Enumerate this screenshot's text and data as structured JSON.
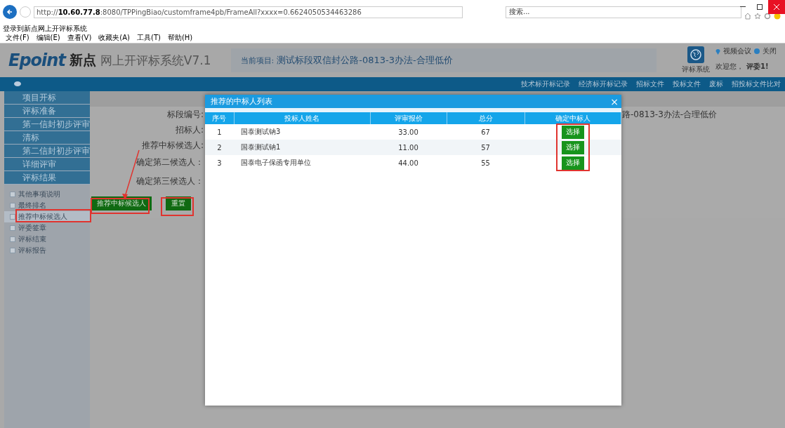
{
  "browser": {
    "url": "http://**10.60.77.8**:8080/TPPingBiao/customframe4pb/FrameAll?xxxx=0.6624050534463286",
    "search_placeholder": "搜索...",
    "tab_title": "登录到新点网上开评标系统",
    "menu": [
      "文件(F)",
      "编辑(E)",
      "查看(V)",
      "收藏夹(A)",
      "工具(T)",
      "帮助(H)"
    ]
  },
  "header": {
    "logo_brand": "Epoint",
    "logo_cn": "新点",
    "system_name": "网上开评标系统V7.1",
    "project_label": "当前项目:",
    "project_name": "测试标段双信封公路-0813-3办法-合理低价",
    "app_button": "评标系统",
    "meeting_link": "视频会议",
    "close_link": "关闭",
    "welcome": "欢迎您，",
    "user": "评委1!"
  },
  "nav": [
    "技术标开标记录",
    "经济标开标记录",
    "招标文件",
    "投标文件",
    "废标",
    "招投标文件比对"
  ],
  "sidebar": {
    "items": [
      {
        "label": "项目开标"
      },
      {
        "label": "评标准备"
      },
      {
        "label": "第一信封初步评审"
      },
      {
        "label": "清标"
      },
      {
        "label": "第二信封初步评审"
      },
      {
        "label": "详细评审"
      },
      {
        "label": "评标结果",
        "children": [
          {
            "label": "其他事项说明",
            "selected": false
          },
          {
            "label": "最终排名",
            "selected": false
          },
          {
            "label": "推荐中标候选人",
            "selected": true
          },
          {
            "label": "评委签章",
            "selected": false
          },
          {
            "label": "评标结束",
            "selected": false
          },
          {
            "label": "评标报告",
            "selected": false
          }
        ]
      }
    ]
  },
  "form": {
    "labels": [
      "标段编号:",
      "招标人:",
      "推荐中标候选人:",
      "确定第二候选人：",
      "确定第三候选人："
    ],
    "section_value": "路-0813-3办法-合理低价",
    "buttons": [
      "推荐中标候选人",
      "重置"
    ]
  },
  "dialog": {
    "title": "推荐的中标人列表",
    "close": "×",
    "columns": [
      "序号",
      "投标人姓名",
      "评审报价",
      "总分",
      "确定中标人"
    ],
    "rows": [
      {
        "index": "1",
        "name": "国泰测试钠3",
        "price": "33.00",
        "score": "67",
        "action": "选择"
      },
      {
        "index": "2",
        "name": "国泰测试钠1",
        "price": "11.00",
        "score": "57",
        "action": "选择"
      },
      {
        "index": "3",
        "name": "国泰电子保函专用单位",
        "price": "44.00",
        "score": "55",
        "action": "选择"
      }
    ]
  }
}
